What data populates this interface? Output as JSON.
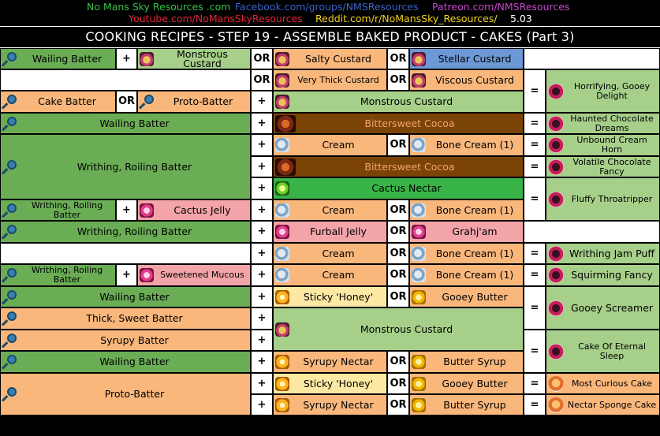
{
  "header": {
    "site": "No Mans Sky Resources .com",
    "facebook": "Facebook.com/groups/NMSResources",
    "patreon": "Patreon.com/NMSResources",
    "youtube": "Youtube.com/NoMansSkyResources",
    "reddit": "Reddit.com/r/NoMansSky_Resources/",
    "version": "5.03",
    "colors": {
      "site": "#35c04a",
      "facebook": "#3a62c9",
      "patreon": "#c347c9",
      "youtube": "#e0243b",
      "reddit": "#f2d21f",
      "version": "#ffffff"
    }
  },
  "title": "COOKING RECIPES - STEP 19 - ASSEMBLE BAKED PRODUCT - CAKES (Part 3)",
  "ops": {
    "plus": "+",
    "or": "OR",
    "eq": "="
  },
  "cells": {
    "r1a": "Wailing Batter",
    "r1b": "Monstrous Custard",
    "r1c": "Salty Custard",
    "r1d": "Stellar Custard",
    "r2c": "Very Thick Custard",
    "r2d": "Viscous Custard",
    "res1": "Horrifying, Gooey Delight",
    "r3a": "Cake Batter",
    "r3b": "Proto-Batter",
    "r3c": "Monstrous Custard",
    "r4a": "Wailing Batter",
    "r4c": "Bittersweet Cocoa",
    "res2": "Haunted Chocolate Dreams",
    "r5a": "Writhing, Roiling Batter",
    "r5c": "Cream",
    "r5d": "Bone Cream (1)",
    "res3": "Unbound Cream Horn",
    "r6c": "Bittersweet Cocoa",
    "res4": "Volatile Chocolate Fancy",
    "r7c": "Cactus Nectar",
    "res5": "Fluffy Throatripper",
    "r8a": "Writhing, Roiling Batter",
    "r8b": "Cactus Jelly",
    "r8c": "Cream",
    "r8d": "Bone Cream (1)",
    "r9a": "Writhing, Roiling Batter",
    "r9c": "Furball Jelly",
    "r9d": "Grahj'am",
    "r10c": "Cream",
    "r10d": "Bone Cream (1)",
    "res6": "Writhing Jam Puff",
    "r11a": "Writhing, Roiling Batter",
    "r11b": "Sweetened Mucous",
    "r11c": "Cream",
    "r11d": "Bone Cream (1)",
    "res7": "Squirming Fancy",
    "r12a": "Wailing Batter",
    "r12c": "Sticky 'Honey'",
    "r12d": "Gooey Butter",
    "res8": "Gooey Screamer",
    "r13a": "Thick, Sweet Batter",
    "r13c": "Monstrous Custard",
    "r14a": "Syrupy Batter",
    "res9": "Cake Of Eternal Sleep",
    "r15a": "Wailing Batter",
    "r15c": "Syrupy Nectar",
    "r15d": "Butter Syrup",
    "r16a": "Proto-Batter",
    "r16c": "Sticky 'Honey'",
    "r16d": "Gooey Butter",
    "res10": "Most Curious Cake",
    "r17c": "Syrupy Nectar",
    "r17d": "Butter Syrup",
    "res11": "Nectar Sponge Cake"
  }
}
